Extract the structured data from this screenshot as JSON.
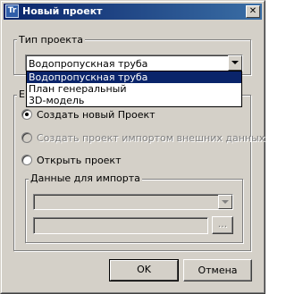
{
  "window": {
    "title": "Новый проект",
    "icon_text": "Tr",
    "close_glyph": "✕"
  },
  "project_type": {
    "caption": "Тип проекта",
    "selected_value": "Водопропускная труба",
    "options": [
      "Водопропускная труба",
      "План генеральный",
      "3D-модель"
    ],
    "highlighted_index": 0
  },
  "actions_group": {
    "caption": "Е",
    "radios": [
      {
        "label": "Создать новый Проект",
        "checked": true,
        "enabled": true
      },
      {
        "label": "Создать проект импортом внешних данных",
        "checked": false,
        "enabled": false
      },
      {
        "label": "Открыть проект",
        "checked": false,
        "enabled": true
      }
    ]
  },
  "import_data": {
    "caption": "Данные для импорта",
    "combo_value": "",
    "path_value": "",
    "browse_label": "..."
  },
  "buttons": {
    "ok_label": "OK",
    "cancel_label": "Отмена"
  }
}
